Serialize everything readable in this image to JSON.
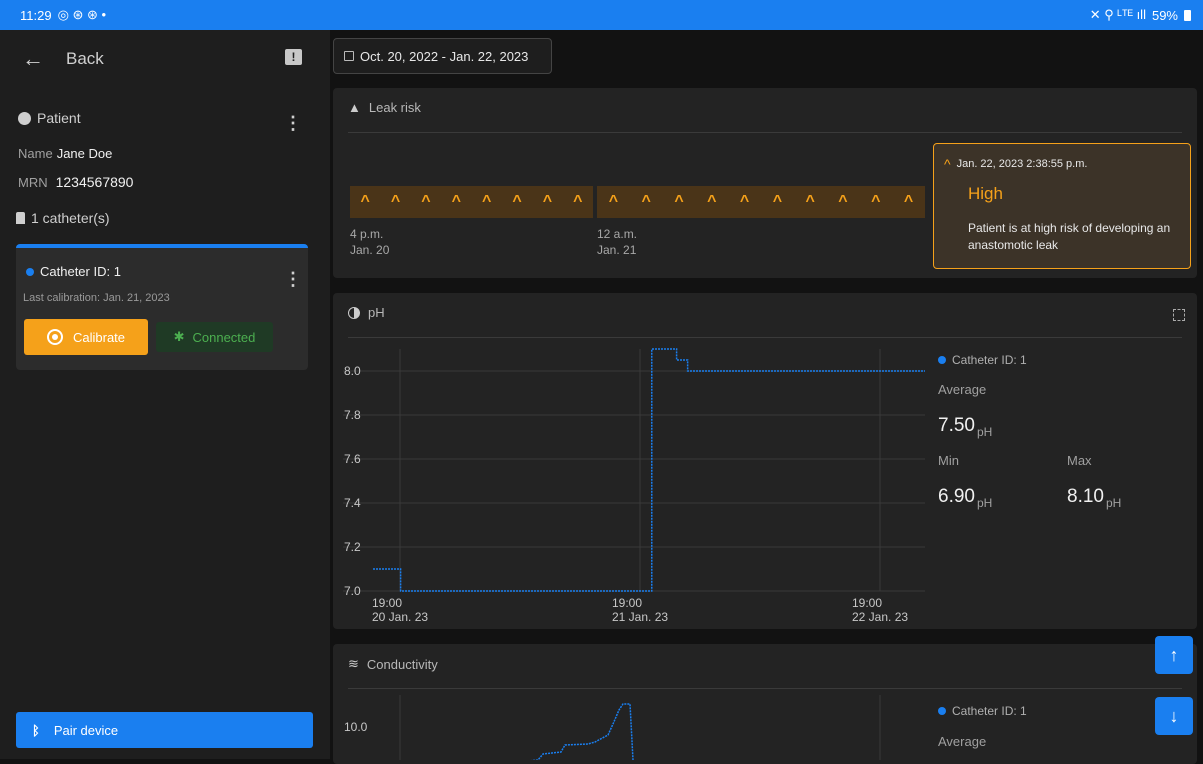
{
  "status_bar": {
    "time": "11:29",
    "left_icons": "◎ ⊛ ⊛ •",
    "right_icons": "✕ ⚲ ᴸᵀᴱ ıll",
    "battery": "59%"
  },
  "nav": {
    "back_label": "Back"
  },
  "patient": {
    "heading": "Patient",
    "name_label": "Name",
    "name": "Jane Doe",
    "mrn_label": "MRN",
    "mrn": "1234567890",
    "catheter_count": "1 catheter(s)"
  },
  "catheter_card": {
    "id_label": "Catheter ID: 1",
    "last_calibration": "Last calibration: Jan. 21, 2023",
    "calibrate_label": "Calibrate",
    "connected_label": "Connected"
  },
  "pair_button": "Pair device",
  "date_range": "Oct. 20, 2022 - Jan. 22, 2023",
  "leak_panel": {
    "title": "Leak risk",
    "ticks": [
      {
        "time": "4 p.m.",
        "date": "Jan. 20"
      },
      {
        "time": "12 a.m.",
        "date": "Jan. 21"
      }
    ],
    "tooltip": {
      "timestamp": "Jan. 22, 2023 2:38:55 p.m.",
      "level": "High",
      "description": "Patient is at high risk of developing an anastomotic leak"
    }
  },
  "ph_panel": {
    "title": "pH",
    "legend": "Catheter ID: 1",
    "average_label": "Average",
    "average_value": "7.50",
    "unit": "pH",
    "min_label": "Min",
    "min_value": "6.90",
    "max_label": "Max",
    "max_value": "8.10"
  },
  "conductivity_panel": {
    "title": "Conductivity",
    "legend": "Catheter ID: 1",
    "average_label": "Average",
    "y_tick": "10.0"
  },
  "colors": {
    "accent": "#1a7ff0",
    "warning": "#f5a11a",
    "success": "#4caf50"
  },
  "chart_data": [
    {
      "type": "line",
      "title": "pH",
      "series": [
        {
          "name": "Catheter ID: 1",
          "points": [
            [
              0.0,
              7.1
            ],
            [
              0.03,
              7.1
            ],
            [
              0.05,
              7.0
            ],
            [
              0.5,
              7.0
            ],
            [
              0.505,
              8.1
            ],
            [
              0.53,
              8.1
            ],
            [
              0.55,
              8.05
            ],
            [
              0.57,
              8.0
            ],
            [
              1.0,
              8.0
            ]
          ]
        }
      ],
      "x_ticks": [
        {
          "time": "19:00",
          "date": "20 Jan. 23"
        },
        {
          "time": "19:00",
          "date": "21 Jan. 23"
        },
        {
          "time": "19:00",
          "date": "22 Jan. 23"
        }
      ],
      "y_ticks": [
        "7.0",
        "7.2",
        "7.4",
        "7.6",
        "7.8",
        "8.0"
      ],
      "ylim": [
        7.0,
        8.1
      ]
    }
  ]
}
